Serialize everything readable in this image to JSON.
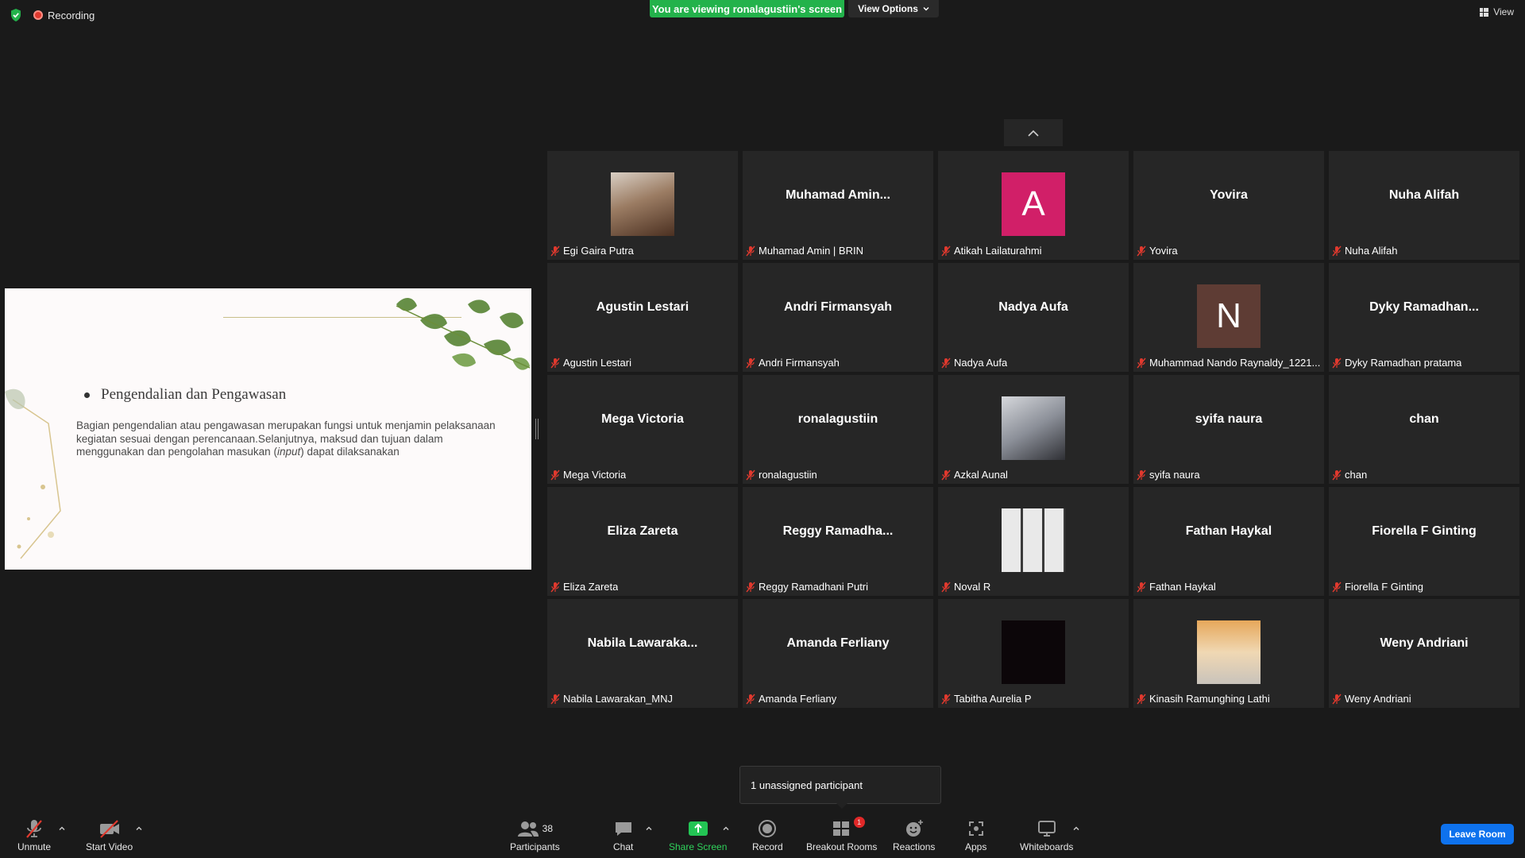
{
  "top": {
    "recording_label": "Recording",
    "viewing_banner": "You are viewing ronalagustiin's screen",
    "view_options_label": "View Options",
    "view_label": "View"
  },
  "slide": {
    "bullet_title": "Pengendalian dan Pengawasan",
    "body_part1": "Bagian pengendalian atau pengawasan merupakan fungsi untuk menjamin pelaksanaan kegiatan sesuai dengan perencanaan.Selanjutnya, maksud dan tujuan dalam menggunakan dan pengolahan masukan (",
    "body_italic": "input",
    "body_part2": ") dapat dilaksanakan"
  },
  "participants": [
    {
      "display": "",
      "label": "Egi Gaira Putra",
      "avatar": "photo"
    },
    {
      "display": "Muhamad  Amin...",
      "label": "Muhamad Amin | BRIN"
    },
    {
      "display": "",
      "label": "Atikah Lailaturahmi",
      "avatar": "letter",
      "letter": "A",
      "color": "#d11f68"
    },
    {
      "display": "Yovira",
      "label": "Yovira"
    },
    {
      "display": "Nuha Alifah",
      "label": "Nuha Alifah"
    },
    {
      "display": "Agustin Lestari",
      "label": "Agustin Lestari"
    },
    {
      "display": "Andri Firmansyah",
      "label": "Andri Firmansyah"
    },
    {
      "display": "Nadya Aufa",
      "label": "Nadya Aufa"
    },
    {
      "display": "",
      "label": "Muhammad Nando Raynaldy_1221...",
      "avatar": "letter",
      "letter": "N",
      "color": "#5e3c34"
    },
    {
      "display": "Dyky  Ramadhan...",
      "label": "Dyky Ramadhan pratama"
    },
    {
      "display": "Mega Victoria",
      "label": "Mega Victoria"
    },
    {
      "display": "ronalagustiin",
      "label": "ronalagustiin"
    },
    {
      "display": "",
      "label": "Azkal Aunal",
      "avatar": "photo2"
    },
    {
      "display": "syifa naura",
      "label": "syifa naura"
    },
    {
      "display": "chan",
      "label": "chan"
    },
    {
      "display": "Eliza Zareta",
      "label": "Eliza Zareta"
    },
    {
      "display": "Reggy  Ramadha...",
      "label": "Reggy Ramadhani Putri"
    },
    {
      "display": "",
      "label": "Noval R",
      "avatar": "photo3"
    },
    {
      "display": "Fathan Haykal",
      "label": "Fathan Haykal"
    },
    {
      "display": "Fiorella F Ginting",
      "label": "Fiorella F Ginting"
    },
    {
      "display": "Nabila  Lawaraka...",
      "label": "Nabila Lawarakan_MNJ"
    },
    {
      "display": "Amanda Ferliany",
      "label": "Amanda Ferliany"
    },
    {
      "display": "",
      "label": "Tabitha Aurelia P",
      "avatar": "black"
    },
    {
      "display": "",
      "label": "Kinasih Ramunghing Lathi",
      "avatar": "photo4"
    },
    {
      "display": "Weny Andriani",
      "label": "Weny Andriani"
    }
  ],
  "popup": {
    "text": "1 unassigned participant"
  },
  "toolbar": {
    "unmute": "Unmute",
    "start_video": "Start Video",
    "participants": "Participants",
    "participants_count": "38",
    "chat": "Chat",
    "share_screen": "Share Screen",
    "record": "Record",
    "breakout_rooms": "Breakout Rooms",
    "breakout_badge": "1",
    "reactions": "Reactions",
    "apps": "Apps",
    "whiteboards": "Whiteboards",
    "leave_room": "Leave Room"
  },
  "colors": {
    "accent_green": "#23b24b",
    "leave_blue": "#0e72ed",
    "muted_red": "#e0392e"
  }
}
